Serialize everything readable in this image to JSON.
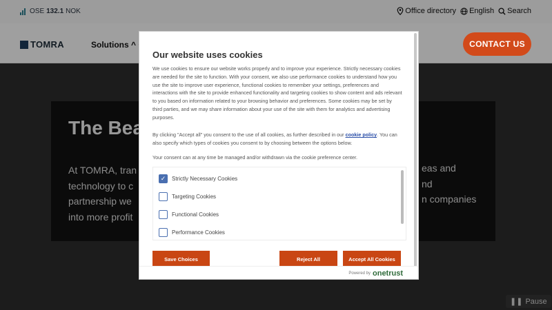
{
  "topbar": {
    "ticker_exchange": "OSE",
    "ticker_price": "132.1",
    "ticker_currency": "NOK",
    "office_directory": "Office directory",
    "language": "English",
    "search": "Search"
  },
  "navbar": {
    "logo_text": "TOMRA",
    "solutions": "Solutions ^ C",
    "contact": "CONTACT US"
  },
  "hero": {
    "title": "The Bea",
    "line1": "At TOMRA, tran",
    "line2": "technology to c",
    "line3": "partnership we",
    "line4": "into more profit",
    "right1": "eas and",
    "right2": "nd",
    "right3": "n companies"
  },
  "modal": {
    "title": "Our website uses cookies",
    "body": "We use cookies to ensure our website works properly and to improve your experience. Strictly necessary cookies are needed for the site to function. With your consent, we also use performance cookies to understand how you use the site to improve user experience, functional cookies to remember your settings, preferences and interactions with the site to provide enhanced functionality and targeting cookies to show content and ads relevant to you based on information related to your browsing behavior and preferences. Some cookies may be set by third parties, and we may share information about your use of the site with them for analytics and advertising purposes.",
    "consent_pre": "By clicking \"Accept all\" you consent to the use of all cookies, as further described in our",
    "consent_link": "cookie policy",
    "consent_post": ". You can also specify which types of cookies you consent to by choosing between the options below.",
    "manage": "Your consent can at any time be managed and/or withdrawn via the cookie preference center.",
    "categories": [
      {
        "label": "Strictly Necessary Cookies",
        "checked": true
      },
      {
        "label": "Targeting Cookies",
        "checked": false
      },
      {
        "label": "Functional Cookies",
        "checked": false
      },
      {
        "label": "Performance Cookies",
        "checked": false
      }
    ],
    "save": "Save Choices",
    "reject": "Reject All",
    "accept": "Accept All Cookies",
    "powered_by": "Powered by",
    "powered_brand": "onetrust"
  },
  "pause": "Pause",
  "colors": {
    "accent": "#d24a1a",
    "checkbox": "#4a6fb0"
  }
}
